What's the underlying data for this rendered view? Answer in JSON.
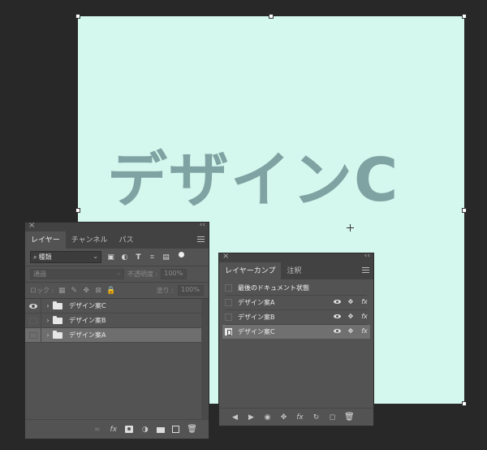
{
  "canvas": {
    "background_color": "#d4f7ee",
    "text": "デザインC",
    "text_color": "#7fa3a2"
  },
  "layers_panel": {
    "close_glyph": "×",
    "collapse_glyph": "‹‹",
    "tabs": [
      {
        "label": "レイヤー",
        "active": true
      },
      {
        "label": "チャンネル",
        "active": false
      },
      {
        "label": "パス",
        "active": false
      }
    ],
    "filter": {
      "search_glyph": "⌕",
      "kind_label": "種類",
      "chevron": "⌄",
      "icons": [
        "image-filter-icon",
        "adjustment-filter-icon",
        "type-filter-icon",
        "shape-filter-icon",
        "smart-object-filter-icon"
      ],
      "icon_glyphs": [
        "▣",
        "◐",
        "T",
        "⌗",
        "▤"
      ]
    },
    "blend_mode": {
      "value": "通過",
      "chevron": "⌄"
    },
    "opacity": {
      "label": "不透明度 :",
      "value": "100%",
      "chevron": "⌄"
    },
    "lock": {
      "label": "ロック :",
      "icon_glyphs": [
        "▦",
        "✎",
        "✥",
        "⊠",
        "🔒"
      ]
    },
    "fill": {
      "label": "塗り :",
      "value": "100%",
      "chevron": "⌄"
    },
    "layers": [
      {
        "name": "デザイン案C",
        "visible": true,
        "selected": false,
        "expand_glyph": "›"
      },
      {
        "name": "デザイン案B",
        "visible": false,
        "selected": false,
        "expand_glyph": "›"
      },
      {
        "name": "デザイン案A",
        "visible": false,
        "selected": true,
        "expand_glyph": "›"
      }
    ],
    "bottom_glyphs": {
      "link": "∞",
      "fx": "fx",
      "adjustment": "◑",
      "trash": "🗑"
    }
  },
  "comps_panel": {
    "close_glyph": "×",
    "collapse_glyph": "‹‹",
    "tabs": [
      {
        "label": "レイヤーカンプ",
        "active": true
      },
      {
        "label": "注釈",
        "active": false
      }
    ],
    "last_state_label": "最後のドキュメント状態",
    "comps": [
      {
        "name": "デザイン案A",
        "applied": false
      },
      {
        "name": "デザイン案B",
        "applied": false
      },
      {
        "name": "デザイン案C",
        "applied": true
      }
    ],
    "row_glyphs": {
      "position": "✥",
      "fx": "fx"
    },
    "bottom_glyphs": {
      "previous": "◀",
      "next": "▶",
      "update_visibility": "◉",
      "update_position": "✥",
      "update_appearance": "fx",
      "update_all": "↻",
      "new_comp": "◻",
      "trash": "🗑"
    }
  }
}
